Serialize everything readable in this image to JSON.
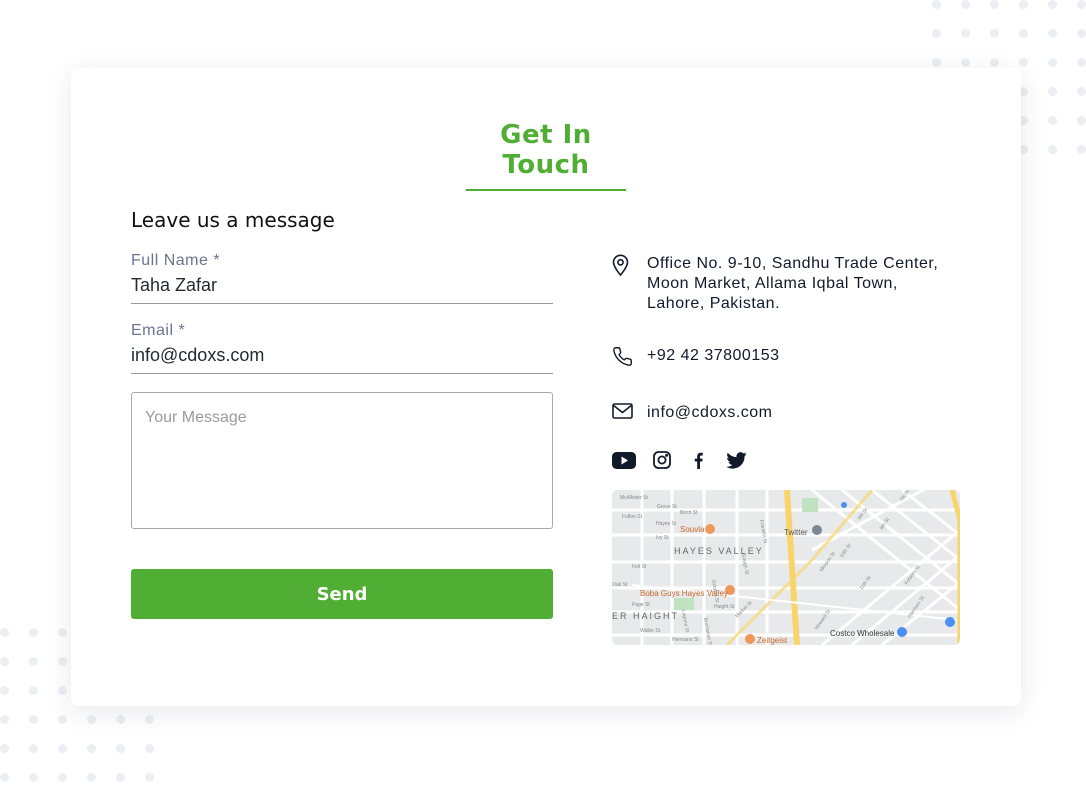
{
  "page": {
    "heading": "Get In Touch",
    "accent_color": "#4fae33"
  },
  "form": {
    "title": "Leave us a message",
    "fields": [
      {
        "label": "Full Name *",
        "value": "Taha Zafar"
      },
      {
        "label": "Email *",
        "value": "info@cdoxs.com"
      }
    ],
    "message_placeholder": "Your Message",
    "send_label": "Send"
  },
  "contact": {
    "address_lines": [
      "Office No. 9-10, Sandhu Trade Center,",
      "Moon Market, Allama Iqbal Town,",
      "Lahore, Pakistan."
    ],
    "phone": "+92 42 37800153",
    "email": "info@cdoxs.com",
    "social_icons": [
      "youtube-icon",
      "instagram-icon",
      "facebook-icon",
      "twitter-icon"
    ]
  },
  "map": {
    "neighborhood_labels": [
      "HAYES VALLEY",
      "ER HAIGHT"
    ],
    "places": [
      "Souvla",
      "Twitter",
      "Boba Guys Hayes Valley",
      "Costco Wholesale",
      "Zeitgeist"
    ],
    "streets": [
      "McAllister St",
      "Fulton St",
      "Grove St",
      "Hayes St",
      "Ivy St",
      "Fell St",
      "Oak St",
      "Page St",
      "Haight St",
      "Waller St",
      "Hermann St",
      "Birch St",
      "Franklin St",
      "Gough St",
      "Octavia St",
      "Laguna St",
      "Buchanan St",
      "Market St",
      "Mission St",
      "Howard St",
      "Folsom St",
      "Harrison St",
      "9th St",
      "10th St",
      "11th St",
      "7th St",
      "8th St"
    ]
  }
}
